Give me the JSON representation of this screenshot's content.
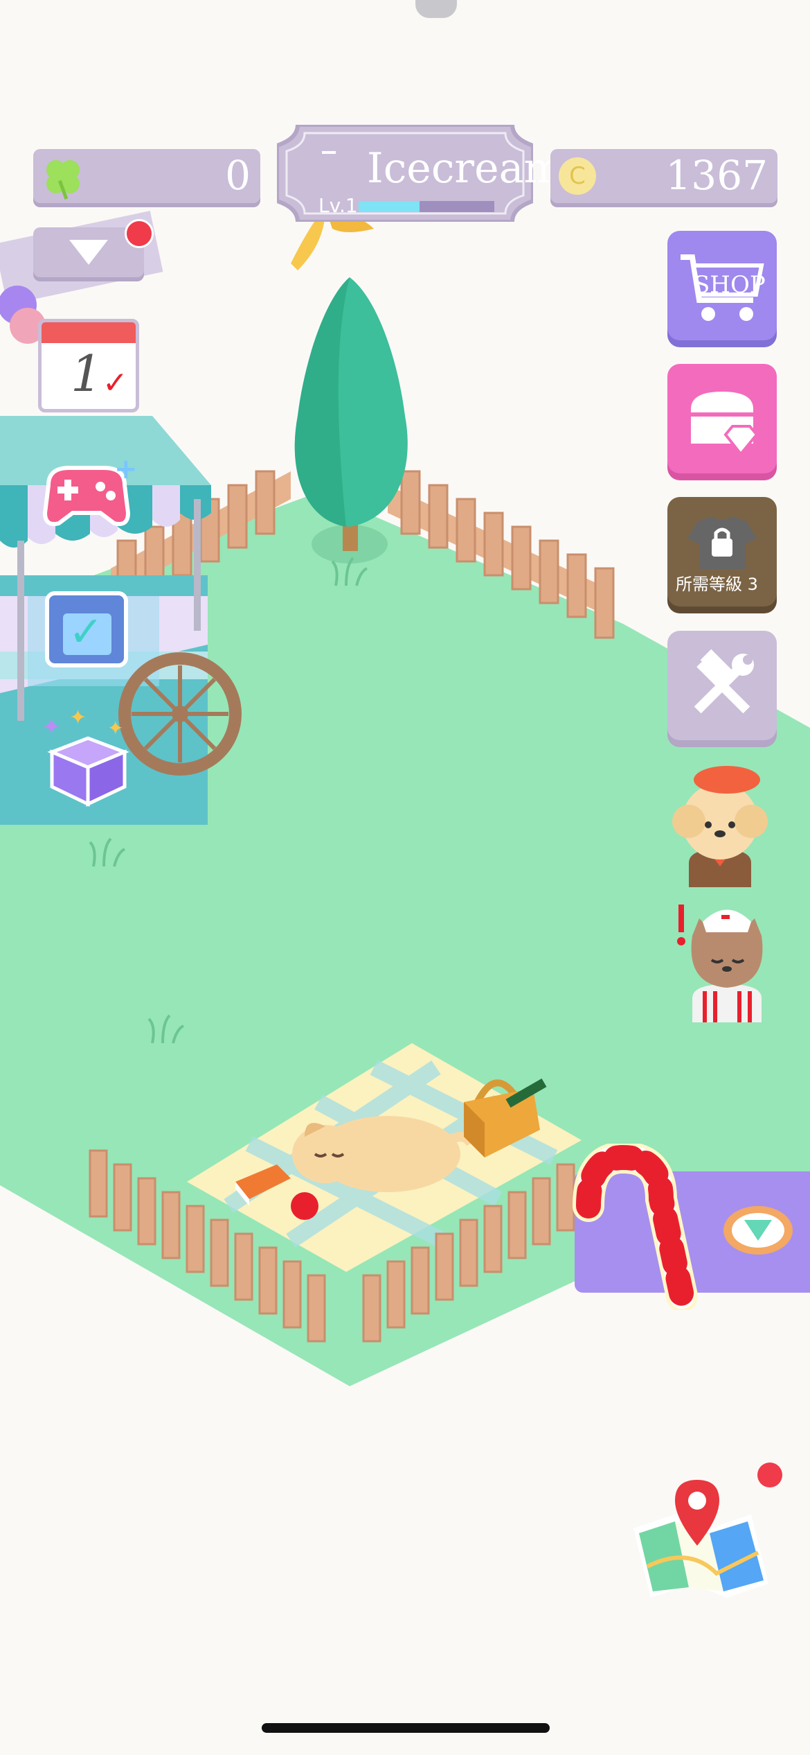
{
  "hud": {
    "clover_count": "0",
    "shop_name": "Icecream",
    "level_label": "Lv.1",
    "level_progress": 0.45,
    "coin_count": "1367"
  },
  "side_buttons": {
    "shop_label": "SHOP",
    "locked_label": "所需等級 3"
  },
  "icons": {
    "clover": "clover-icon",
    "coin": "coin-icon",
    "dropdown": "dropdown-arrow-icon",
    "calendar": "calendar-icon",
    "calendar_day": "1",
    "gamepad": "gamepad-icon",
    "tasks": "clipboard-check-icon",
    "gift_box": "gift-box-icon",
    "shop": "shopping-cart-icon",
    "chest": "treasure-chest-icon",
    "lock": "lock-shirt-icon",
    "tools": "hammer-wrench-icon",
    "map": "map-icon",
    "candy": "candy-cane-icon",
    "diamond": "diamond-icon"
  },
  "colors": {
    "grass": "#97e6b7",
    "panel": "#c9bdd8",
    "shop_btn": "#9f88ee",
    "chest_btn": "#f36bbd",
    "locked_btn": "#7b6445",
    "notification": "#ef3b4a"
  }
}
